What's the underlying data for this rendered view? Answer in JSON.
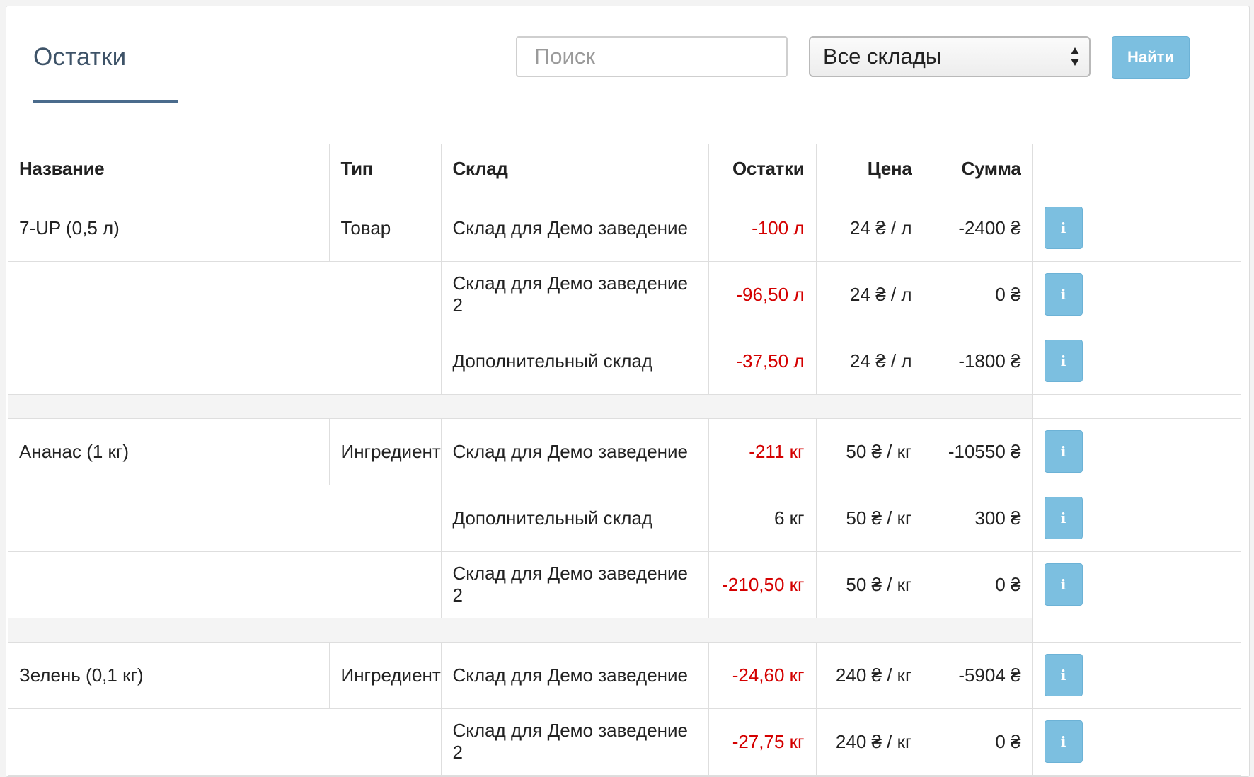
{
  "header": {
    "title": "Остатки",
    "search_placeholder": "Поиск",
    "warehouse_select": "Все склады",
    "find_button": "Найти"
  },
  "table": {
    "columns": [
      "Название",
      "Тип",
      "Склад",
      "Остатки",
      "Цена",
      "Сумма"
    ],
    "groups": [
      {
        "name": "7-UP (0,5 л)",
        "type": "Товар",
        "rows": [
          {
            "warehouse": "Склад для Демо заведение",
            "stock": "-100 л",
            "negative": true,
            "price": "24 ₴ / л",
            "sum": "-2400 ₴"
          },
          {
            "warehouse": "Склад для Демо заведение 2",
            "stock": "-96,50 л",
            "negative": true,
            "price": "24 ₴ / л",
            "sum": "0 ₴"
          },
          {
            "warehouse": "Дополнительный склад",
            "stock": "-37,50 л",
            "negative": true,
            "price": "24 ₴ / л",
            "sum": "-1800 ₴"
          }
        ]
      },
      {
        "name": "Ананас (1 кг)",
        "type": "Ингредиент",
        "rows": [
          {
            "warehouse": "Склад для Демо заведение",
            "stock": "-211 кг",
            "negative": true,
            "price": "50 ₴ / кг",
            "sum": "-10550 ₴"
          },
          {
            "warehouse": "Дополнительный склад",
            "stock": "6 кг",
            "negative": false,
            "price": "50 ₴ / кг",
            "sum": "300 ₴"
          },
          {
            "warehouse": "Склад для Демо заведение 2",
            "stock": "-210,50 кг",
            "negative": true,
            "price": "50 ₴ / кг",
            "sum": "0 ₴"
          }
        ]
      },
      {
        "name": "Зелень (0,1 кг)",
        "type": "Ингредиент",
        "rows": [
          {
            "warehouse": "Склад для Демо заведение",
            "stock": "-24,60 кг",
            "negative": true,
            "price": "240 ₴ / кг",
            "sum": "-5904 ₴"
          },
          {
            "warehouse": "Склад для Демо заведение 2",
            "stock": "-27,75 кг",
            "negative": true,
            "price": "240 ₴ / кг",
            "sum": "0 ₴"
          }
        ]
      }
    ],
    "info_button_label": "i"
  },
  "colors": {
    "accent": "#7cbfe0",
    "negative": "#d40000",
    "title": "#3e5368"
  },
  "icons": {
    "select_arrows": "sort-arrows-icon",
    "info": "info-icon"
  }
}
